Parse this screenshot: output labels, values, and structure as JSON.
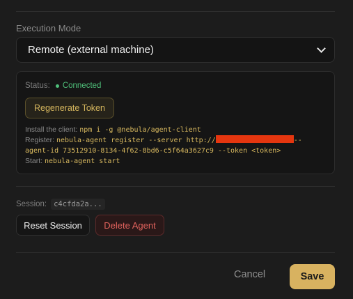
{
  "execution_mode": {
    "label": "Execution Mode",
    "selected": "Remote (external machine)"
  },
  "agent_card": {
    "status_label": "Status:",
    "status_value": "Connected",
    "status_color": "#4fc07a",
    "regenerate_label": "Regenerate Token",
    "install_label": "Install the client:",
    "install_cmd": "npm i -g @nebula/agent-client",
    "register_label": "Register:",
    "register_cmd_pre": "nebula-agent register --server http://",
    "register_cmd_post": "--",
    "register_cmd_line2": "agent-id 73512910-8134-4f62-8bd6-c5f64a3627c9 --token <token>",
    "start_label": "Start:",
    "start_cmd": "nebula-agent start"
  },
  "session": {
    "label": "Session:",
    "id": "c4cfda2a..."
  },
  "actions": {
    "reset_label": "Reset Session",
    "delete_label": "Delete Agent"
  },
  "footer": {
    "cancel_label": "Cancel",
    "save_label": "Save"
  },
  "colors": {
    "accent": "#d8b260",
    "danger": "#e0625c",
    "redaction": "#e5360f"
  }
}
